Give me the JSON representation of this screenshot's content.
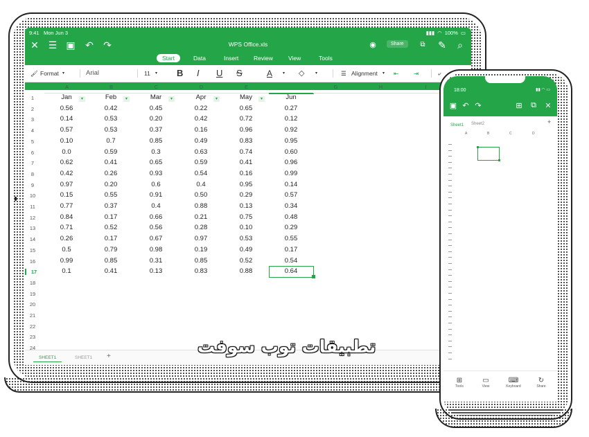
{
  "status": {
    "time": "9:41",
    "date": "Mon Jun 3",
    "battery": "100%"
  },
  "doc_title": "WPS Office.xls",
  "share_label": "Share",
  "ribbon_tabs": [
    "Start",
    "Data",
    "Insert",
    "Review",
    "View",
    "Tools"
  ],
  "active_tab": "Start",
  "toolbar": {
    "format_label": "Format",
    "font_name": "Arial",
    "font_size": "11",
    "bold": "B",
    "italic": "I",
    "underline": "U",
    "strike": "S",
    "font_color": "A",
    "alignment_label": "Alignment"
  },
  "columns": [
    "A",
    "B",
    "C",
    "D",
    "E",
    "F",
    "G",
    "H",
    "I"
  ],
  "active_column": "F",
  "headers": [
    "Jan",
    "Feb",
    "Mar",
    "Apr",
    "May",
    "Jun"
  ],
  "rows": [
    [
      "0.56",
      "0.42",
      "0.45",
      "0.22",
      "0.65",
      "0.27"
    ],
    [
      "0.14",
      "0.53",
      "0.20",
      "0.42",
      "0.72",
      "0.12"
    ],
    [
      "0.57",
      "0.53",
      "0.37",
      "0.16",
      "0.96",
      "0.92"
    ],
    [
      "0.10",
      "0.7",
      "0.85",
      "0.49",
      "0.83",
      "0.95"
    ],
    [
      "0.0",
      "0.59",
      "0.3",
      "0.63",
      "0.74",
      "0.60"
    ],
    [
      "0.62",
      "0.41",
      "0.65",
      "0.59",
      "0.41",
      "0.96"
    ],
    [
      "0.42",
      "0.26",
      "0.93",
      "0.54",
      "0.16",
      "0.99"
    ],
    [
      "0.97",
      "0.20",
      "0.6",
      "0.4",
      "0.95",
      "0.14"
    ],
    [
      "0.15",
      "0.55",
      "0.91",
      "0.50",
      "0.29",
      "0.57"
    ],
    [
      "0.77",
      "0.37",
      "0.4",
      "0.88",
      "0.13",
      "0.34"
    ],
    [
      "0.84",
      "0.17",
      "0.66",
      "0.21",
      "0.75",
      "0.48"
    ],
    [
      "0.71",
      "0.52",
      "0.56",
      "0.28",
      "0.10",
      "0.29"
    ],
    [
      "0.26",
      "0.17",
      "0.67",
      "0.97",
      "0.53",
      "0.55"
    ],
    [
      "0.5",
      "0.79",
      "0.98",
      "0.19",
      "0.49",
      "0.17"
    ],
    [
      "0.99",
      "0.85",
      "0.31",
      "0.85",
      "0.52",
      "0.54"
    ],
    [
      "0.1",
      "0.41",
      "0.13",
      "0.83",
      "0.88",
      "0.64"
    ]
  ],
  "row_numbers": [
    "1",
    "2",
    "3",
    "4",
    "5",
    "6",
    "7",
    "8",
    "9",
    "10",
    "11",
    "12",
    "13",
    "14",
    "15",
    "16",
    "17",
    "18",
    "19",
    "20",
    "21",
    "22",
    "23",
    "24"
  ],
  "active_row": "17",
  "sheet_tabs": [
    "SHEET1",
    "SHEET1"
  ],
  "watermark": "تطبيقات توب سوفت",
  "phone": {
    "time": "18:00",
    "sheet_tabs": [
      "Sheet1",
      "Sheet2"
    ],
    "columns": [
      "A",
      "B",
      "C",
      "D"
    ],
    "bottom_items": [
      "Tools",
      "View",
      "Keyboard",
      "Share"
    ]
  },
  "colors": {
    "accent": "#23a548",
    "text": "#222222"
  }
}
